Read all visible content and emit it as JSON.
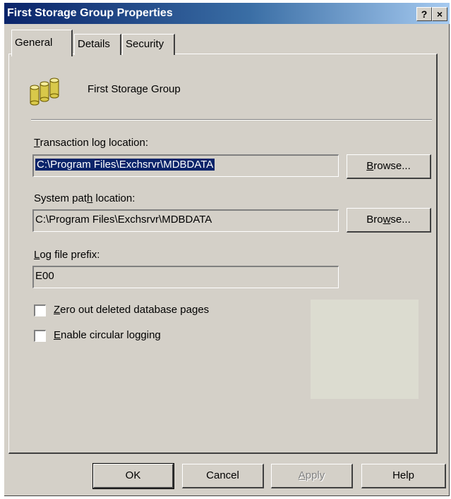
{
  "window": {
    "title": "First Storage Group Properties",
    "help_glyph": "?",
    "close_glyph": "×"
  },
  "tabs": [
    {
      "label": "General",
      "active": true
    },
    {
      "label": "Details",
      "active": false
    },
    {
      "label": "Security",
      "active": false
    }
  ],
  "header": {
    "icon": "storage-group-icon",
    "name": "First Storage Group"
  },
  "transaction_log": {
    "label_ul": "T",
    "label_rest": "ransaction log location:",
    "value": "C:\\Program Files\\Exchsrvr\\MDBDATA",
    "browse_ul": "B",
    "browse_rest": "rowse..."
  },
  "system_path": {
    "label_pre": "System pat",
    "label_ul": "h",
    "label_post": " location:",
    "value": "C:\\Program Files\\Exchsrvr\\MDBDATA",
    "browse_pre": "Bro",
    "browse_ul": "w",
    "browse_post": "se..."
  },
  "log_prefix": {
    "label_ul": "L",
    "label_rest": "og file prefix:",
    "value": "E00"
  },
  "checkboxes": [
    {
      "label_ul": "Z",
      "label_rest": "ero out deleted database pages",
      "checked": false
    },
    {
      "label_ul": "E",
      "label_rest": "nable circular logging",
      "checked": false
    }
  ],
  "buttons": {
    "ok": "OK",
    "cancel": "Cancel",
    "apply_ul": "A",
    "apply_rest": "pply",
    "help": "Help"
  },
  "colors": {
    "title_bar": "#0a246a",
    "dialog_face": "#d4d0c8",
    "selection": "#0a246a"
  }
}
